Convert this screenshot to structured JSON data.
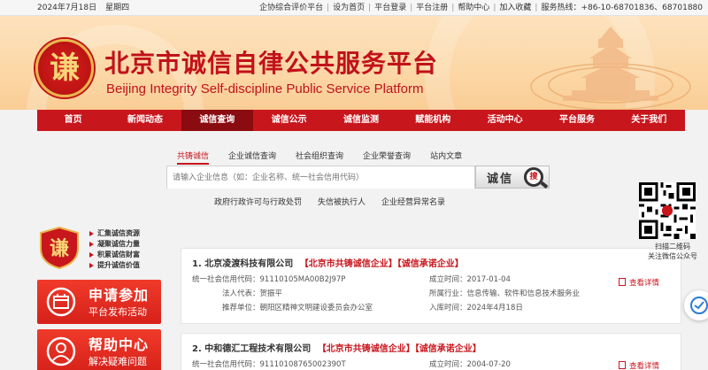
{
  "topbar": {
    "date": "2024年7月18日",
    "weekday": "星期四",
    "links": [
      "企协综合评价平台",
      "设为首页",
      "平台登录",
      "平台注册",
      "帮助中心",
      "加入收藏"
    ],
    "hotline": "服务热线：+86-10-68701836、68701880"
  },
  "header": {
    "logo_char": "谦",
    "title_cn": "北京市诚信自律公共服务平台",
    "title_en": "Beijing Integrity Self-discipline Public Service Platform"
  },
  "nav": {
    "items": [
      "首页",
      "新闻动态",
      "诚信查询",
      "诚信公示",
      "诚信监测",
      "赋能机构",
      "活动中心",
      "平台服务",
      "关于我们"
    ],
    "active_index": 2
  },
  "search": {
    "tabs": [
      "共铸诚信",
      "企业诚信查询",
      "社会组织查询",
      "企业荣誉查询",
      "站内文章"
    ],
    "active_tab": 0,
    "placeholder": "请输入企业信息（如：企业名称、统一社会信用代码）",
    "button_label": "诚信",
    "button_badge": "搜",
    "sub_links": [
      "政府行政许可与行政处罚",
      "失信被执行人",
      "企业经营异常名录"
    ]
  },
  "side": {
    "logo_char": "谦",
    "list": [
      "汇集诚信资源",
      "凝聚诚信力量",
      "积累诚信财富",
      "提升诚信价值"
    ],
    "promos": [
      {
        "t1": "申请参加",
        "t2": "平台发布活动"
      },
      {
        "t1": "帮助中心",
        "t2": "解决疑难问题"
      }
    ]
  },
  "results": [
    {
      "index": "1.",
      "name": "北京凌渡科技有限公司",
      "tags": [
        "【北京市共铸诚信企业】",
        "【诚信承诺企业】"
      ],
      "credit_label": "统一社会信用代码：",
      "credit_code": "91110105MA00B2J97P",
      "rep_label": "法人代表：",
      "rep": "贺振平",
      "unit_label": "推荐单位：",
      "unit": "朝阳区精神文明建设委员会办公室",
      "founded_label": "成立时间：",
      "founded": "2017-01-04",
      "industry_label": "所属行业：",
      "industry": "信息传输、软件和信息技术服务业",
      "joined_label": "入库时间：",
      "joined": "2024年4月18日",
      "detail": "查看详情"
    },
    {
      "index": "2.",
      "name": "中和德汇工程技术有限公司",
      "tags": [
        "【北京市共铸诚信企业】",
        "【诚信承诺企业】"
      ],
      "credit_label": "统一社会信用代码：",
      "credit_code": "91110108765002390T",
      "founded_label": "成立时间：",
      "founded": "2004-07-20",
      "detail": "查看详情"
    }
  ],
  "qr": {
    "caption1": "扫描二维码",
    "caption2": "关注微信公众号"
  },
  "colors": {
    "brand_red": "#c8161d",
    "nav_active": "#8a0b10",
    "banner": "#fcd7a6"
  }
}
